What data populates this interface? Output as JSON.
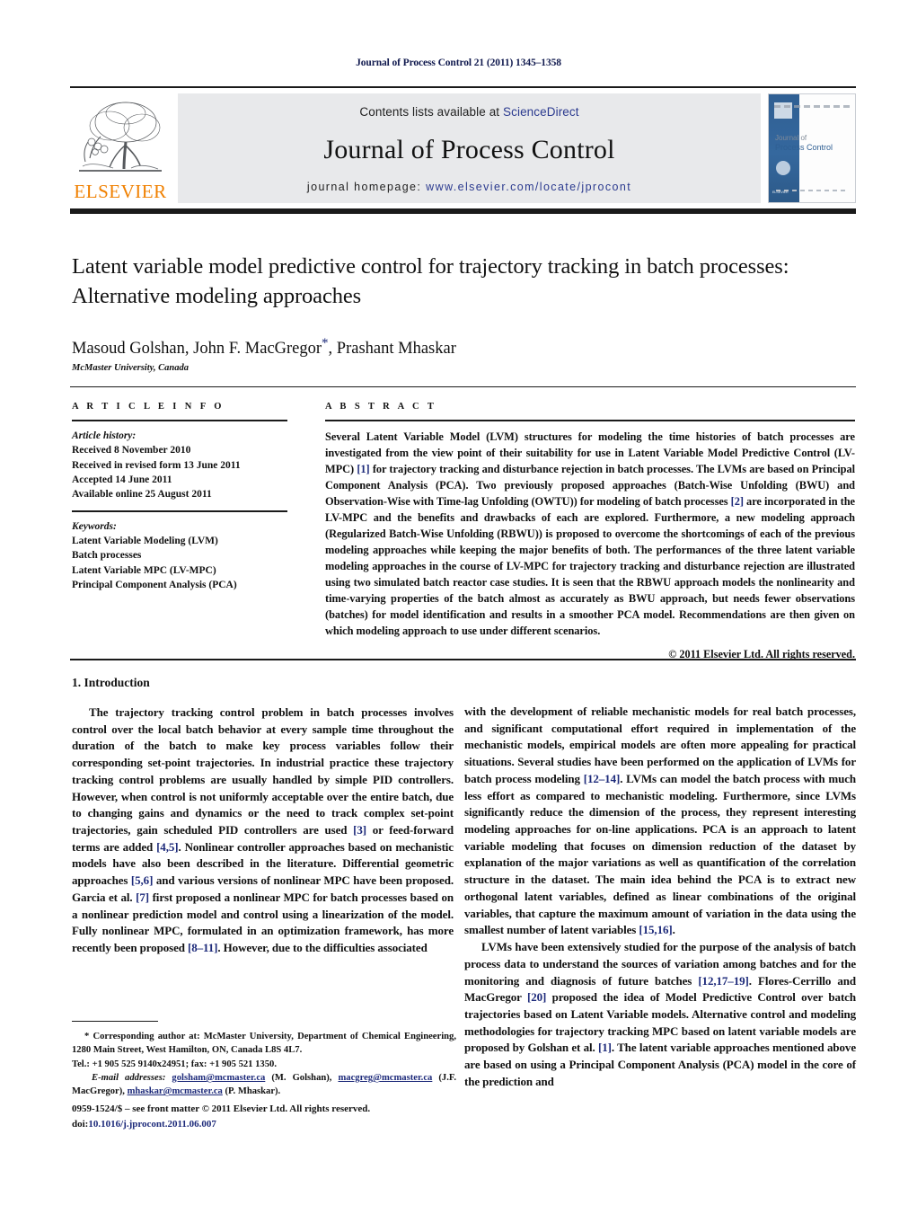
{
  "running_head": "Journal of Process Control 21 (2011) 1345–1358",
  "masthead": {
    "publisher_wordmark": "ELSEVIER",
    "contents_prefix": "Contents lists available at ",
    "contents_link": "ScienceDirect",
    "journal_name": "Journal of Process Control",
    "homepage_prefix": "journal homepage: ",
    "homepage_url": "www.elsevier.com/locate/jprocont",
    "cover": {
      "line1": "Journal of",
      "line2": "Process Control",
      "publisher_small": "ELSEVIER"
    },
    "colors": {
      "link_blue": "#2b3a8f",
      "elsevier_orange": "#f08000",
      "banner_gray": "#e8e9eb",
      "cover_blue": "#2f5f93"
    }
  },
  "article": {
    "title": "Latent variable model predictive control for trajectory tracking in batch processes: Alternative modeling approaches",
    "authors": "Masoud Golshan, John F. MacGregor",
    "authors_tail": ", Prashant Mhaskar",
    "corresponding_marker": "*",
    "affiliation": "McMaster University, Canada"
  },
  "article_info": {
    "heading": "A R T I C L E    I N F O",
    "history_label": "Article history:",
    "history": [
      "Received 8 November 2010",
      "Received in revised form 13 June 2011",
      "Accepted 14 June 2011",
      "Available online 25 August 2011"
    ],
    "keywords_label": "Keywords:",
    "keywords": [
      "Latent Variable Modeling (LVM)",
      "Batch processes",
      "Latent Variable MPC (LV-MPC)",
      "Principal Component Analysis (PCA)"
    ]
  },
  "abstract": {
    "heading": "A B S T R A C T",
    "paragraph_1": "Several Latent Variable Model (LVM) structures for modeling the time histories of batch processes are investigated from the view point of their suitability for use in Latent Variable Model Predictive Control (LV-MPC) ",
    "ref_1": "[1]",
    "paragraph_2": " for trajectory tracking and disturbance rejection in batch processes. The LVMs are based on Principal Component Analysis (PCA). Two previously proposed approaches (Batch-Wise Unfolding (BWU) and Observation-Wise with Time-lag Unfolding (OWTU)) for modeling of batch processes ",
    "ref_2": "[2]",
    "paragraph_3": " are incorporated in the LV-MPC and the benefits and drawbacks of each are explored. Furthermore, a new modeling approach (Regularized Batch-Wise Unfolding (RBWU)) is proposed to overcome the shortcomings of each of the previous modeling approaches while keeping the major benefits of both. The performances of the three latent variable modeling approaches in the course of LV-MPC for trajectory tracking and disturbance rejection are illustrated using two simulated batch reactor case studies. It is seen that the RBWU approach models the nonlinearity and time-varying properties of the batch almost as accurately as BWU approach, but needs fewer observations (batches) for model identification and results in a smoother PCA model. Recommendations are then given on which modeling approach to use under different scenarios.",
    "copyright": "© 2011 Elsevier Ltd. All rights reserved."
  },
  "introduction": {
    "section_title": "1. Introduction",
    "left_p1_a": "The trajectory tracking control problem in batch processes involves control over the local batch behavior at every sample time throughout the duration of the batch to make key process variables follow their corresponding set-point trajectories. In industrial practice these trajectory tracking control problems are usually handled by simple PID controllers. However, when control is not uniformly acceptable over the entire batch, due to changing gains and dynamics or the need to track complex set-point trajectories, gain scheduled PID controllers are used ",
    "ref_3": "[3]",
    "left_p1_b": " or feed-forward terms are added ",
    "ref_45": "[4,5]",
    "left_p1_c": ". Nonlinear controller approaches based on mechanistic models have also been described in the literature. Differential geometric approaches ",
    "ref_56": "[5,6]",
    "left_p1_d": " and various versions of nonlinear MPC have been proposed. Garcia et al. ",
    "ref_7": "[7]",
    "left_p1_e": " first proposed a nonlinear MPC for batch processes based on a nonlinear prediction model and control using a linearization of the model. Fully nonlinear MPC, formulated in an optimization framework, has more recently been proposed ",
    "ref_811": "[8–11]",
    "left_p1_f": ". However, due to the difficulties associated",
    "right_p1_a": "with the development of reliable mechanistic models for real batch processes, and significant computational effort required in implementation of the mechanistic models, empirical models are often more appealing for practical situations. Several studies have been performed on the application of LVMs for batch process modeling ",
    "ref_1214": "[12–14]",
    "right_p1_b": ". LVMs can model the batch process with much less effort as compared to mechanistic modeling. Furthermore, since LVMs significantly reduce the dimension of the process, they represent interesting modeling approaches for on-line applications. PCA is an approach to latent variable modeling that focuses on dimension reduction of the dataset by explanation of the major variations as well as quantification of the correlation structure in the dataset. The main idea behind the PCA is to extract new orthogonal latent variables, defined as linear combinations of the original variables, that capture the maximum amount of variation in the data using the smallest number of latent variables ",
    "ref_1516": "[15,16]",
    "right_p1_c": ".",
    "right_p2_a": "LVMs have been extensively studied for the purpose of the analysis of batch process data to understand the sources of variation among batches and for the monitoring and diagnosis of future batches ",
    "ref_121719": "[12,17–19]",
    "right_p2_b": ". Flores-Cerrillo and MacGregor ",
    "ref_20": "[20]",
    "right_p2_c": " proposed the idea of Model Predictive Control over batch trajectories based on Latent Variable models. Alternative control and modeling methodologies for trajectory tracking MPC based on latent variable models are proposed by Golshan et al. ",
    "ref_1b": "[1]",
    "right_p2_d": ". The latent variable approaches mentioned above are based on using a Principal Component Analysis (PCA) model in the core of the prediction and"
  },
  "footnotes": {
    "corresponding_marker": "*",
    "corresponding_text": " Corresponding author at: McMaster University, Department of Chemical Engineering, 1280 Main Street, West Hamilton, ON, Canada L8S 4L7.",
    "tel_text": "Tel.: +1 905 525 9140x24951; fax: +1 905 521 1350.",
    "email_label": "E-mail addresses:",
    "email_1": "golsham@mcmaster.ca",
    "email_1_owner": " (M. Golshan), ",
    "email_2": "macgreg@mcmaster.ca",
    "email_2_owner": " (J.F. MacGregor), ",
    "email_3": "mhaskar@mcmaster.ca",
    "email_3_owner": " (P. Mhaskar)."
  },
  "imprint": {
    "line1": "0959-1524/$ – see front matter © 2011 Elsevier Ltd. All rights reserved.",
    "doi_label": "doi:",
    "doi": "10.1016/j.jprocont.2011.06.007"
  }
}
